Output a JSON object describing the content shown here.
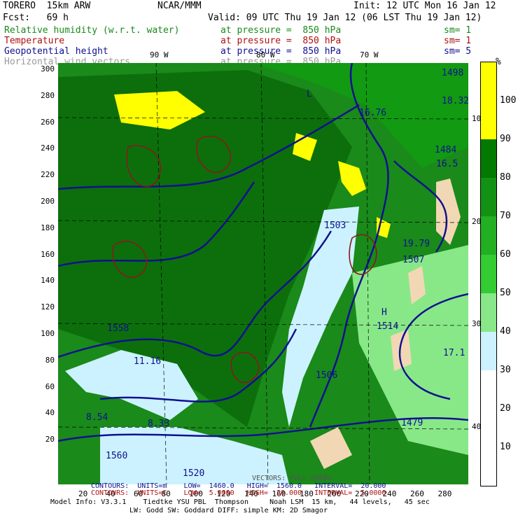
{
  "header": {
    "model": "TORERO  15km ARW",
    "org": "NCAR/MMM",
    "init": "Init: 12 UTC Mon 16 Jan 12",
    "fcst": "Fcst:   69 h",
    "valid": "Valid: 09 UTC Thu 19 Jan 12 (06 LST Thu 19 Jan 12)"
  },
  "fields": [
    {
      "name": "Relative humidity (w.r.t. water)",
      "pressure": "at pressure =  850 hPa",
      "sm": "sm= 1",
      "color": "#1a8a1a"
    },
    {
      "name": "Temperature",
      "pressure": "at pressure =  850 hPa",
      "sm": "sm= 1",
      "color": "#b01010"
    },
    {
      "name": "Geopotential height",
      "pressure": "at pressure =  850 hPa",
      "sm": "sm= 5",
      "color": "#101090"
    },
    {
      "name": "Horizontal wind vectors",
      "pressure": "at pressure =  850 hPa",
      "sm": "",
      "color": "#9a9a9a"
    }
  ],
  "legend": {
    "unit": "%",
    "ticks": [
      "100",
      "90",
      "80",
      "70",
      "60",
      "50",
      "40",
      "30",
      "20",
      "10"
    ],
    "colors": [
      "#ffff00",
      "#ffff00",
      "#007a00",
      "#129212",
      "#22b022",
      "#33cc33",
      "#88e888",
      "#ccf2ff",
      "#ffffff",
      "#ffffff",
      "#ffffff"
    ]
  },
  "longitudes": [
    "90 W",
    "80 W",
    "70 W"
  ],
  "latitudes": [
    "10 S",
    "20 S",
    "30 S",
    "40 S"
  ],
  "y_axis": [
    "300",
    "280",
    "260",
    "240",
    "220",
    "200",
    "180",
    "160",
    "140",
    "120",
    "100",
    "80",
    "60",
    "40",
    "20"
  ],
  "x_axis": [
    "20",
    "40",
    "60",
    "80",
    "100",
    "120",
    "140",
    "160",
    "180",
    "200",
    "220",
    "240",
    "260",
    "280"
  ],
  "contour_labels": [
    {
      "text": "1498",
      "color": "#101090"
    },
    {
      "text": "18.32",
      "color": "#101090"
    },
    {
      "text": "16.76",
      "color": "#101090"
    },
    {
      "text": "1484",
      "color": "#101090"
    },
    {
      "text": "16.5",
      "color": "#101090"
    },
    {
      "text": "1503",
      "color": "#101090"
    },
    {
      "text": "1507",
      "color": "#101090"
    },
    {
      "text": "1514",
      "color": "#101090"
    },
    {
      "text": "1506",
      "color": "#101090"
    },
    {
      "text": "1558",
      "color": "#101090"
    },
    {
      "text": "1560",
      "color": "#101090"
    },
    {
      "text": "1520",
      "color": "#101090"
    },
    {
      "text": "1479",
      "color": "#101090"
    },
    {
      "text": "19.79",
      "color": "#101090"
    },
    {
      "text": "17.1",
      "color": "#101090"
    },
    {
      "text": "11.16",
      "color": "#101090"
    },
    {
      "text": "8.54",
      "color": "#101090"
    },
    {
      "text": "8.33",
      "color": "#101090"
    },
    {
      "text": "H",
      "color": "#101090"
    },
    {
      "text": "L",
      "color": "#101090"
    }
  ],
  "footer": {
    "contours_line1": "CONTOURS:  UNITS=m    LOW=  1460.0   HIGH=  1560.0   INTERVAL=  20.000",
    "contours_line2": "CONTOURS:  UNITS=C    LOW=  5.0000   HIGH=  20.000   INTERVAL=  5.0000",
    "vectors": "VECTORS: FULL BARB=",
    "model_info": "Model Info: V3.3.1    Tiedtke YSU PBL  Thompson     Noah LSM  15 km,   44 levels,   45 sec",
    "model_info2": "LW: Godd SW: Goddard DIFF: simple KM: 2D Smagor"
  }
}
